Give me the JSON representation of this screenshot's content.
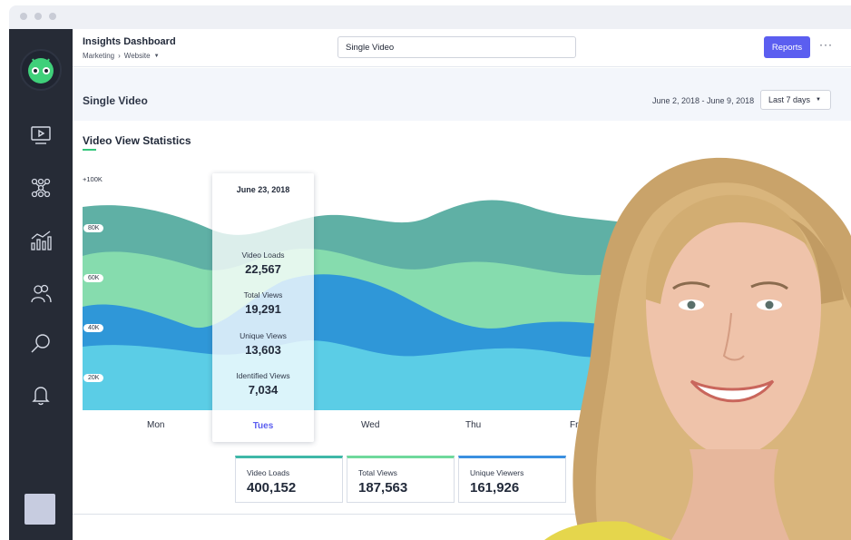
{
  "header": {
    "app_title": "Insights Dashboard",
    "breadcrumb": [
      "Marketing",
      "Website"
    ],
    "search_value": "Single Video",
    "reports_label": "Reports",
    "more_label": "···"
  },
  "subheader": {
    "page_title": "Single Video",
    "date_range": "June 2, 2018 - June 9, 2018",
    "range_select": "Last 7 days"
  },
  "chart": {
    "title": "Video View Statistics",
    "y_top_label": "+100K",
    "y_ticks": [
      "80K",
      "60K",
      "40K",
      "20K"
    ],
    "x_labels": [
      "Mon",
      "Tues",
      "Wed",
      "Thu",
      "Fri"
    ],
    "colors": {
      "identified": "#5bcde6",
      "unique": "#2f97d8",
      "total": "#86dcae",
      "loads": "#5fb0a5",
      "accent": "#5b5ef0"
    }
  },
  "tooltip": {
    "date": "June 23, 2018",
    "rows": [
      {
        "label": "Video Loads",
        "value": "22,567"
      },
      {
        "label": "Total Views",
        "value": "19,291"
      },
      {
        "label": "Unique Views",
        "value": "13,603"
      },
      {
        "label": "Identified Views",
        "value": "7,034"
      }
    ],
    "day": "Tues"
  },
  "stats": [
    {
      "label": "Video Loads",
      "value": "400,152",
      "color": "#3fb8a8"
    },
    {
      "label": "Total Views",
      "value": "187,563",
      "color": "#6fd99c"
    },
    {
      "label": "Unique Viewers",
      "value": "161,926",
      "color": "#3a8fe0"
    }
  ],
  "sidebar": {
    "icons": [
      "video-icon",
      "network-icon",
      "analytics-icon",
      "users-icon",
      "search-icon",
      "bell-icon"
    ]
  }
}
